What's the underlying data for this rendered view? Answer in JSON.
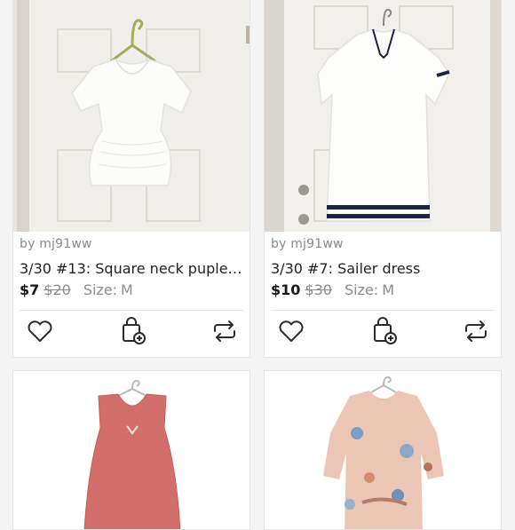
{
  "listings": [
    {
      "seller": "by mj91ww",
      "title": "3/30 #13: Square neck puple…",
      "price": "$7",
      "original_price": "$20",
      "size_label": "Size:",
      "size_value": "M",
      "photo": "white-peasant-blouse-on-hanger",
      "icons": [
        "heart-icon",
        "bag-add-icon",
        "share-icon"
      ]
    },
    {
      "seller": "by mj91ww",
      "title": "3/30 #7: Sailer dress",
      "price": "$10",
      "original_price": "$30",
      "size_label": "Size:",
      "size_value": "M",
      "photo": "white-sailor-dress-on-door",
      "icons": [
        "heart-icon",
        "bag-add-icon",
        "share-icon"
      ]
    },
    {
      "photo": "red-checked-sleeveless-dress"
    },
    {
      "photo": "floral-wrap-dress"
    }
  ],
  "colors": {
    "background": "#f4f4f4",
    "card": "#ffffff",
    "text": "#222222",
    "muted": "#8a8a8a",
    "icon": "#2b2b2b"
  }
}
